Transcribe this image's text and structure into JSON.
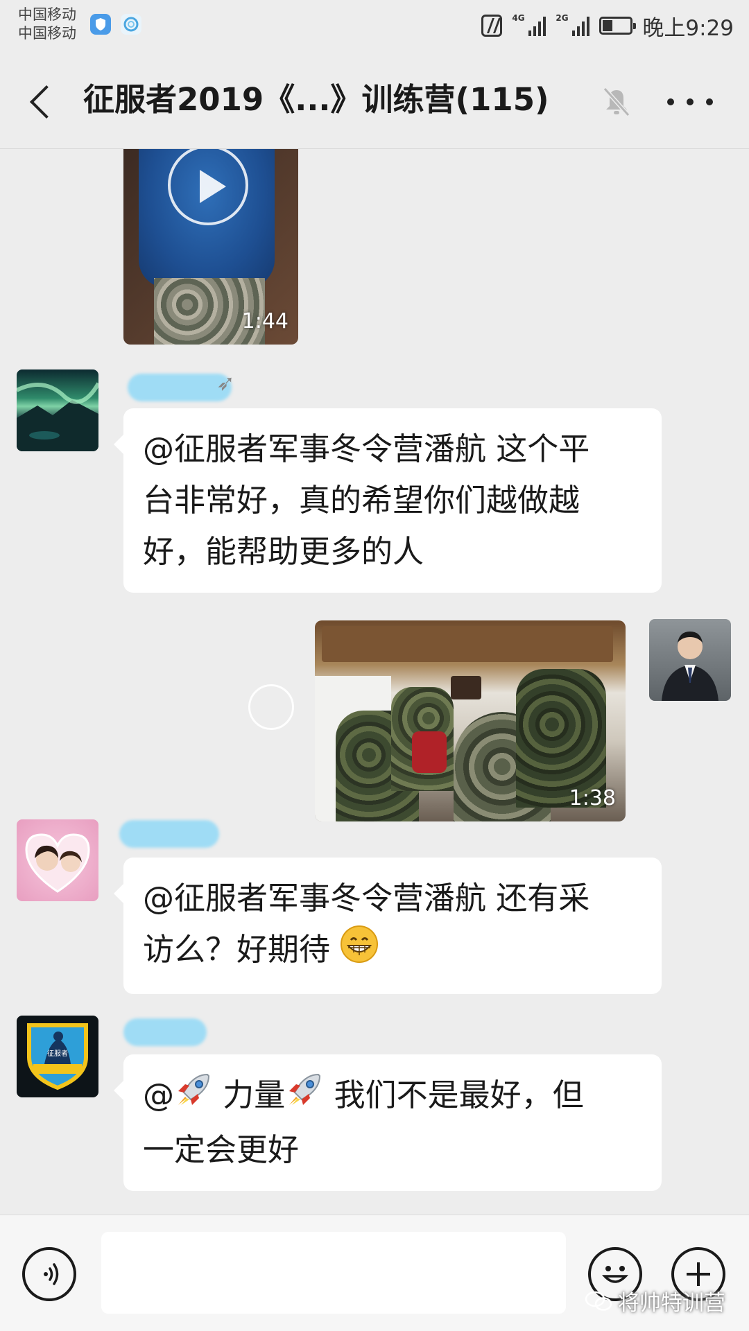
{
  "status_bar": {
    "carrier_1": "中国移动",
    "carrier_2": "中国移动",
    "network_1": "4G",
    "network_2": "2G",
    "time": "晚上9:29"
  },
  "header": {
    "title": "征服者2019《...》训练营(115)"
  },
  "messages": [
    {
      "type": "video",
      "side": "left",
      "duration": "1:44"
    },
    {
      "type": "text",
      "side": "left",
      "avatar": "aurora-landscape",
      "lines": [
        "@征服者军事冬令营潘航  这个平",
        "台非常好，真的希望你们越做越",
        "好，能帮助更多的人"
      ]
    },
    {
      "type": "video",
      "side": "right",
      "duration": "1:38"
    },
    {
      "type": "text",
      "side": "left",
      "avatar": "girls-photo",
      "lines": [
        "@征服者军事冬令营潘航  还有采",
        "访么？好期待"
      ],
      "emoji": "grinning-face"
    },
    {
      "type": "text",
      "side": "left",
      "avatar": "conqueror-badge",
      "lines_parts": {
        "line1_prefix": "@",
        "line1_mid": " 力量",
        "line1_suffix": " 我们不是最好，但",
        "line2": "一定会更好"
      },
      "emoji": "rocket"
    }
  ],
  "watermark": "将帅特训营",
  "colors": {
    "background": "#ededed",
    "bubble": "#ffffff",
    "name_blur": "#9fdcf5",
    "toolbar": "#f6f6f6"
  },
  "icons": [
    "nfc-icon",
    "signal-icon",
    "battery-icon",
    "back-icon",
    "mute-bell-icon",
    "more-icon",
    "voice-icon",
    "emoji-icon",
    "plus-icon",
    "play-icon"
  ]
}
